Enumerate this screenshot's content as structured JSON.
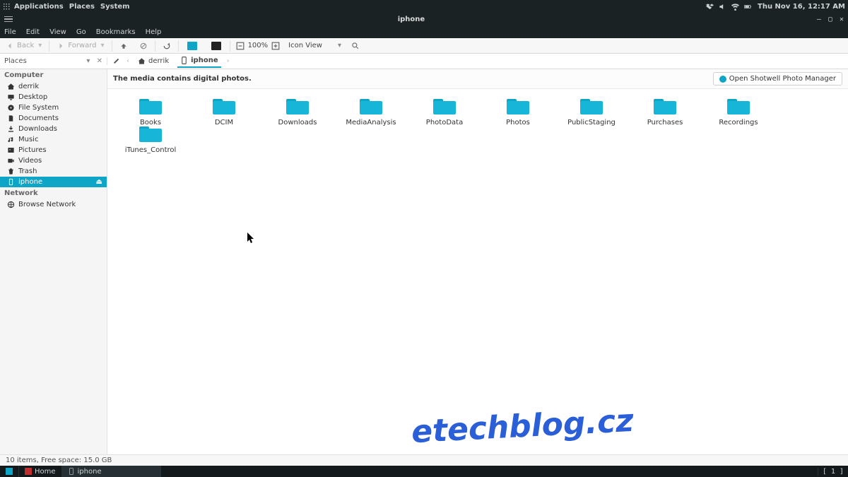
{
  "panel": {
    "menus": [
      "Applications",
      "Places",
      "System"
    ],
    "clock": "Thu Nov 16, 12:17 AM"
  },
  "window": {
    "title": "iphone",
    "controls": {
      "min": "—",
      "max": "▢",
      "close": "✕"
    }
  },
  "menubar": [
    "File",
    "Edit",
    "View",
    "Go",
    "Bookmarks",
    "Help"
  ],
  "toolbar": {
    "back": "Back",
    "forward": "Forward",
    "zoom": "100%",
    "view_mode": "Icon View"
  },
  "path": {
    "places_label": "Places",
    "crumbs": [
      {
        "label": "derrik",
        "icon": "home"
      },
      {
        "label": "iphone",
        "icon": "device"
      }
    ]
  },
  "sidebar": {
    "groups": [
      {
        "label": "Computer",
        "items": [
          {
            "label": "derrik",
            "icon": "home"
          },
          {
            "label": "Desktop",
            "icon": "desktop"
          },
          {
            "label": "File System",
            "icon": "disk"
          },
          {
            "label": "Documents",
            "icon": "doc"
          },
          {
            "label": "Downloads",
            "icon": "down"
          },
          {
            "label": "Music",
            "icon": "music"
          },
          {
            "label": "Pictures",
            "icon": "pic"
          },
          {
            "label": "Videos",
            "icon": "video"
          },
          {
            "label": "Trash",
            "icon": "trash"
          },
          {
            "label": "iphone",
            "icon": "device",
            "active": true,
            "eject": true
          }
        ]
      },
      {
        "label": "Network",
        "items": [
          {
            "label": "Browse Network",
            "icon": "net"
          }
        ]
      }
    ]
  },
  "infobar": {
    "message": "The media contains digital photos.",
    "action": "Open Shotwell Photo Manager"
  },
  "folders": [
    "Books",
    "DCIM",
    "Downloads",
    "MediaAnalysis",
    "PhotoData",
    "Photos",
    "PublicStaging",
    "Purchases",
    "Recordings",
    "iTunes_Control"
  ],
  "statusbar": "10 items, Free space: 15.0 GB",
  "taskbar": {
    "home": "Home",
    "active": "iphone",
    "workspace": "[ 1 ]"
  },
  "watermark": "etechblog.cz"
}
